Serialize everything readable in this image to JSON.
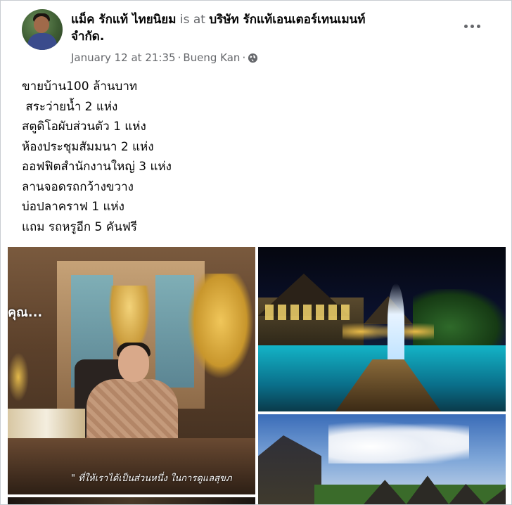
{
  "post": {
    "author": "แม็ค รักแท้ ไทยนิยม",
    "at_text": "is at",
    "place_line1": "บริษัท รักแท้เอนเตอร์เทนเมนท์",
    "place_line2": "จำกัด.",
    "date": "January 12 at 21:35",
    "separator": "·",
    "location": "Bueng Kan",
    "audience_icon": "globe-icon",
    "lines": [
      "ขายบ้าน100 ล้านบาท",
      " สระว่ายน้ำ 2 แห่ง",
      "สตูดิโอผับส่วนตัว 1 แห่ง",
      "ห้องประชุมสัมมนา 2 แห่ง",
      "ออฟฟิตสำนักงานใหญ่ 3 แห่ง",
      "ลานจอดรถกว้างขวาง",
      "บ่อปลาคราฟ 1 แห่ง",
      "แถม รถหรูอีก 5 คันฟรี"
    ]
  },
  "photos": {
    "photo1_overlay": "คุณ...",
    "photo1_caption": "\" ที่ให้เราได้เป็นส่วนหนึ่ง ในการดูแลสุขภ"
  },
  "colors": {
    "text": "#050505",
    "muted": "#65676b",
    "border": "#c9ccd1"
  }
}
